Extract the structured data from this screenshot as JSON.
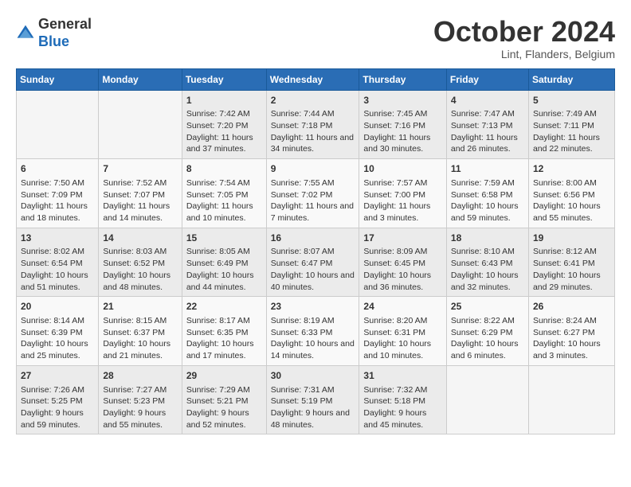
{
  "header": {
    "logo": {
      "line1": "General",
      "line2": "Blue"
    },
    "month_title": "October 2024",
    "subtitle": "Lint, Flanders, Belgium"
  },
  "days_of_week": [
    "Sunday",
    "Monday",
    "Tuesday",
    "Wednesday",
    "Thursday",
    "Friday",
    "Saturday"
  ],
  "weeks": [
    [
      {
        "day": "",
        "sunrise": "",
        "sunset": "",
        "daylight": ""
      },
      {
        "day": "",
        "sunrise": "",
        "sunset": "",
        "daylight": ""
      },
      {
        "day": "1",
        "sunrise": "Sunrise: 7:42 AM",
        "sunset": "Sunset: 7:20 PM",
        "daylight": "Daylight: 11 hours and 37 minutes."
      },
      {
        "day": "2",
        "sunrise": "Sunrise: 7:44 AM",
        "sunset": "Sunset: 7:18 PM",
        "daylight": "Daylight: 11 hours and 34 minutes."
      },
      {
        "day": "3",
        "sunrise": "Sunrise: 7:45 AM",
        "sunset": "Sunset: 7:16 PM",
        "daylight": "Daylight: 11 hours and 30 minutes."
      },
      {
        "day": "4",
        "sunrise": "Sunrise: 7:47 AM",
        "sunset": "Sunset: 7:13 PM",
        "daylight": "Daylight: 11 hours and 26 minutes."
      },
      {
        "day": "5",
        "sunrise": "Sunrise: 7:49 AM",
        "sunset": "Sunset: 7:11 PM",
        "daylight": "Daylight: 11 hours and 22 minutes."
      }
    ],
    [
      {
        "day": "6",
        "sunrise": "Sunrise: 7:50 AM",
        "sunset": "Sunset: 7:09 PM",
        "daylight": "Daylight: 11 hours and 18 minutes."
      },
      {
        "day": "7",
        "sunrise": "Sunrise: 7:52 AM",
        "sunset": "Sunset: 7:07 PM",
        "daylight": "Daylight: 11 hours and 14 minutes."
      },
      {
        "day": "8",
        "sunrise": "Sunrise: 7:54 AM",
        "sunset": "Sunset: 7:05 PM",
        "daylight": "Daylight: 11 hours and 10 minutes."
      },
      {
        "day": "9",
        "sunrise": "Sunrise: 7:55 AM",
        "sunset": "Sunset: 7:02 PM",
        "daylight": "Daylight: 11 hours and 7 minutes."
      },
      {
        "day": "10",
        "sunrise": "Sunrise: 7:57 AM",
        "sunset": "Sunset: 7:00 PM",
        "daylight": "Daylight: 11 hours and 3 minutes."
      },
      {
        "day": "11",
        "sunrise": "Sunrise: 7:59 AM",
        "sunset": "Sunset: 6:58 PM",
        "daylight": "Daylight: 10 hours and 59 minutes."
      },
      {
        "day": "12",
        "sunrise": "Sunrise: 8:00 AM",
        "sunset": "Sunset: 6:56 PM",
        "daylight": "Daylight: 10 hours and 55 minutes."
      }
    ],
    [
      {
        "day": "13",
        "sunrise": "Sunrise: 8:02 AM",
        "sunset": "Sunset: 6:54 PM",
        "daylight": "Daylight: 10 hours and 51 minutes."
      },
      {
        "day": "14",
        "sunrise": "Sunrise: 8:03 AM",
        "sunset": "Sunset: 6:52 PM",
        "daylight": "Daylight: 10 hours and 48 minutes."
      },
      {
        "day": "15",
        "sunrise": "Sunrise: 8:05 AM",
        "sunset": "Sunset: 6:49 PM",
        "daylight": "Daylight: 10 hours and 44 minutes."
      },
      {
        "day": "16",
        "sunrise": "Sunrise: 8:07 AM",
        "sunset": "Sunset: 6:47 PM",
        "daylight": "Daylight: 10 hours and 40 minutes."
      },
      {
        "day": "17",
        "sunrise": "Sunrise: 8:09 AM",
        "sunset": "Sunset: 6:45 PM",
        "daylight": "Daylight: 10 hours and 36 minutes."
      },
      {
        "day": "18",
        "sunrise": "Sunrise: 8:10 AM",
        "sunset": "Sunset: 6:43 PM",
        "daylight": "Daylight: 10 hours and 32 minutes."
      },
      {
        "day": "19",
        "sunrise": "Sunrise: 8:12 AM",
        "sunset": "Sunset: 6:41 PM",
        "daylight": "Daylight: 10 hours and 29 minutes."
      }
    ],
    [
      {
        "day": "20",
        "sunrise": "Sunrise: 8:14 AM",
        "sunset": "Sunset: 6:39 PM",
        "daylight": "Daylight: 10 hours and 25 minutes."
      },
      {
        "day": "21",
        "sunrise": "Sunrise: 8:15 AM",
        "sunset": "Sunset: 6:37 PM",
        "daylight": "Daylight: 10 hours and 21 minutes."
      },
      {
        "day": "22",
        "sunrise": "Sunrise: 8:17 AM",
        "sunset": "Sunset: 6:35 PM",
        "daylight": "Daylight: 10 hours and 17 minutes."
      },
      {
        "day": "23",
        "sunrise": "Sunrise: 8:19 AM",
        "sunset": "Sunset: 6:33 PM",
        "daylight": "Daylight: 10 hours and 14 minutes."
      },
      {
        "day": "24",
        "sunrise": "Sunrise: 8:20 AM",
        "sunset": "Sunset: 6:31 PM",
        "daylight": "Daylight: 10 hours and 10 minutes."
      },
      {
        "day": "25",
        "sunrise": "Sunrise: 8:22 AM",
        "sunset": "Sunset: 6:29 PM",
        "daylight": "Daylight: 10 hours and 6 minutes."
      },
      {
        "day": "26",
        "sunrise": "Sunrise: 8:24 AM",
        "sunset": "Sunset: 6:27 PM",
        "daylight": "Daylight: 10 hours and 3 minutes."
      }
    ],
    [
      {
        "day": "27",
        "sunrise": "Sunrise: 7:26 AM",
        "sunset": "Sunset: 5:25 PM",
        "daylight": "Daylight: 9 hours and 59 minutes."
      },
      {
        "day": "28",
        "sunrise": "Sunrise: 7:27 AM",
        "sunset": "Sunset: 5:23 PM",
        "daylight": "Daylight: 9 hours and 55 minutes."
      },
      {
        "day": "29",
        "sunrise": "Sunrise: 7:29 AM",
        "sunset": "Sunset: 5:21 PM",
        "daylight": "Daylight: 9 hours and 52 minutes."
      },
      {
        "day": "30",
        "sunrise": "Sunrise: 7:31 AM",
        "sunset": "Sunset: 5:19 PM",
        "daylight": "Daylight: 9 hours and 48 minutes."
      },
      {
        "day": "31",
        "sunrise": "Sunrise: 7:32 AM",
        "sunset": "Sunset: 5:18 PM",
        "daylight": "Daylight: 9 hours and 45 minutes."
      },
      {
        "day": "",
        "sunrise": "",
        "sunset": "",
        "daylight": ""
      },
      {
        "day": "",
        "sunrise": "",
        "sunset": "",
        "daylight": ""
      }
    ]
  ]
}
